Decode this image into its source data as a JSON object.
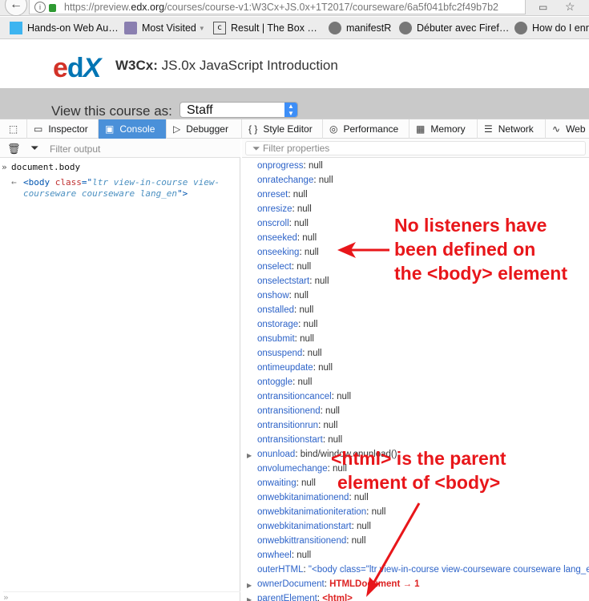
{
  "browser": {
    "url_prefix": "https://preview.",
    "url_domain": "edx.org",
    "url_rest": "/courses/course-v1:W3Cx+JS.0x+1T2017/courseware/6a5f041bfc2f49b7b2",
    "bookmarks": [
      {
        "label": "Hands-on Web Au…",
        "icon": "square-icon"
      },
      {
        "label": "Most Visited",
        "icon": "folder-icon"
      },
      {
        "label": "Result | The Box …",
        "icon": "page-icon"
      },
      {
        "label": "manifestR",
        "icon": "globe-icon"
      },
      {
        "label": "Débuter avec Firef…",
        "icon": "globe-icon"
      },
      {
        "label": "How do I enri",
        "icon": "globe-icon"
      }
    ]
  },
  "page": {
    "logo": {
      "e": "e",
      "d": "d",
      "x": "X"
    },
    "course_org": "W3Cx:",
    "course_name": " JS.0x JavaScript Introduction",
    "view_as_label": "View this course as:",
    "view_as_value": "Staff"
  },
  "devtools": {
    "tabs": [
      {
        "label": "Inspector",
        "icon": "inspector-icon"
      },
      {
        "label": "Console",
        "icon": "console-icon"
      },
      {
        "label": "Debugger",
        "icon": "debugger-icon"
      },
      {
        "label": "Style Editor",
        "icon": "style-editor-icon"
      },
      {
        "label": "Performance",
        "icon": "performance-icon"
      },
      {
        "label": "Memory",
        "icon": "memory-icon"
      },
      {
        "label": "Network",
        "icon": "network-icon"
      },
      {
        "label": "Web",
        "icon": "web-icon"
      }
    ],
    "active_tab": "Console",
    "console": {
      "filter_placeholder": "Filter output",
      "input": "document.body",
      "output_tag_open": "<body ",
      "output_attr": "class",
      "output_eq": "=\"",
      "output_value": "ltr view-in-course view-courseware courseware  lang_en",
      "output_close": "\">"
    },
    "properties": {
      "filter_placeholder": "Filter properties",
      "rows": [
        {
          "key": "onprogress",
          "value": "null",
          "kind": "plain"
        },
        {
          "key": "onratechange",
          "value": "null",
          "kind": "plain"
        },
        {
          "key": "onreset",
          "value": "null",
          "kind": "plain"
        },
        {
          "key": "onresize",
          "value": "null",
          "kind": "plain"
        },
        {
          "key": "onscroll",
          "value": "null",
          "kind": "plain"
        },
        {
          "key": "onseeked",
          "value": "null",
          "kind": "plain"
        },
        {
          "key": "onseeking",
          "value": "null",
          "kind": "plain"
        },
        {
          "key": "onselect",
          "value": "null",
          "kind": "plain"
        },
        {
          "key": "onselectstart",
          "value": "null",
          "kind": "plain"
        },
        {
          "key": "onshow",
          "value": "null",
          "kind": "plain"
        },
        {
          "key": "onstalled",
          "value": "null",
          "kind": "plain"
        },
        {
          "key": "onstorage",
          "value": "null",
          "kind": "plain"
        },
        {
          "key": "onsubmit",
          "value": "null",
          "kind": "plain"
        },
        {
          "key": "onsuspend",
          "value": "null",
          "kind": "plain"
        },
        {
          "key": "ontimeupdate",
          "value": "null",
          "kind": "plain"
        },
        {
          "key": "ontoggle",
          "value": "null",
          "kind": "plain"
        },
        {
          "key": "ontransitioncancel",
          "value": "null",
          "kind": "plain"
        },
        {
          "key": "ontransitionend",
          "value": "null",
          "kind": "plain"
        },
        {
          "key": "ontransitionrun",
          "value": "null",
          "kind": "plain"
        },
        {
          "key": "ontransitionstart",
          "value": "null",
          "kind": "plain"
        },
        {
          "key": "onunload",
          "value": "bind/window.onunload()",
          "kind": "plain",
          "expandable": true
        },
        {
          "key": "onvolumechange",
          "value": "null",
          "kind": "plain"
        },
        {
          "key": "onwaiting",
          "value": "null",
          "kind": "plain"
        },
        {
          "key": "onwebkitanimationend",
          "value": "null",
          "kind": "plain"
        },
        {
          "key": "onwebkitanimationiteration",
          "value": "null",
          "kind": "plain"
        },
        {
          "key": "onwebkitanimationstart",
          "value": "null",
          "kind": "plain"
        },
        {
          "key": "onwebkittransitionend",
          "value": "null",
          "kind": "plain"
        },
        {
          "key": "onwheel",
          "value": "null",
          "kind": "plain"
        },
        {
          "key": "outerHTML",
          "value": "\"<body class=\"ltr view-in-course view-courseware courseware  lang_en\">",
          "kind": "str"
        },
        {
          "key": "ownerDocument",
          "value": "HTMLDocument → 1",
          "kind": "node",
          "expandable": true
        },
        {
          "key": "parentElement",
          "value": "<html>",
          "kind": "node",
          "expandable": true
        }
      ]
    }
  },
  "annotations": {
    "top": [
      "No listeners have",
      "been defined on",
      "the <body> element"
    ],
    "bottom": [
      "<html> is the parent",
      "element of <body>"
    ],
    "color": "#e8161a"
  }
}
